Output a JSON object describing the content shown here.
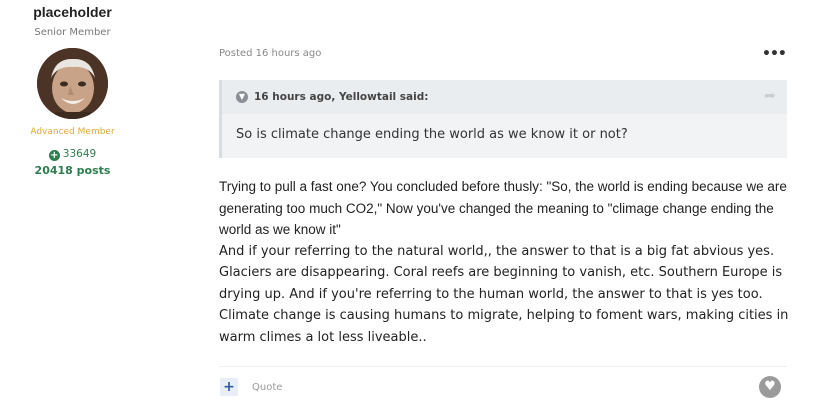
{
  "author": {
    "name": "placeholder",
    "title": "Senior Member",
    "rank": "Advanced Member",
    "reputation": "33649",
    "posts": "20418 posts"
  },
  "post": {
    "meta": "Posted 16 hours ago",
    "quote": {
      "cite": "16 hours ago, Yellowtail said:",
      "text": "So is climate change ending the world as we know it or not?"
    },
    "paragraphs": [
      "Trying to pull a fast one? You concluded before thusly:  \"So, the world is ending because we are generating too much CO2,\" Now you've changed the meaning to \"climage change ending the world as we know it\"",
      "And if your referring to the natural world,, the answer to that is a big fat abvious yes. Glaciers are disappearing. Coral reefs are  beginning to vanish, etc. Southern Europe is drying up. And if you're referring to the human world, the answer to that is yes too. Climate change is causing humans to migrate, helping to foment wars, making cities in warm climes a lot less liveable.."
    ],
    "actions": {
      "plus": "+",
      "quote_label": "Quote"
    }
  },
  "colors": {
    "accent_green": "#2e7d4f",
    "rank_gold": "#e2a93b",
    "quote_bg": "#f1f3f5"
  }
}
